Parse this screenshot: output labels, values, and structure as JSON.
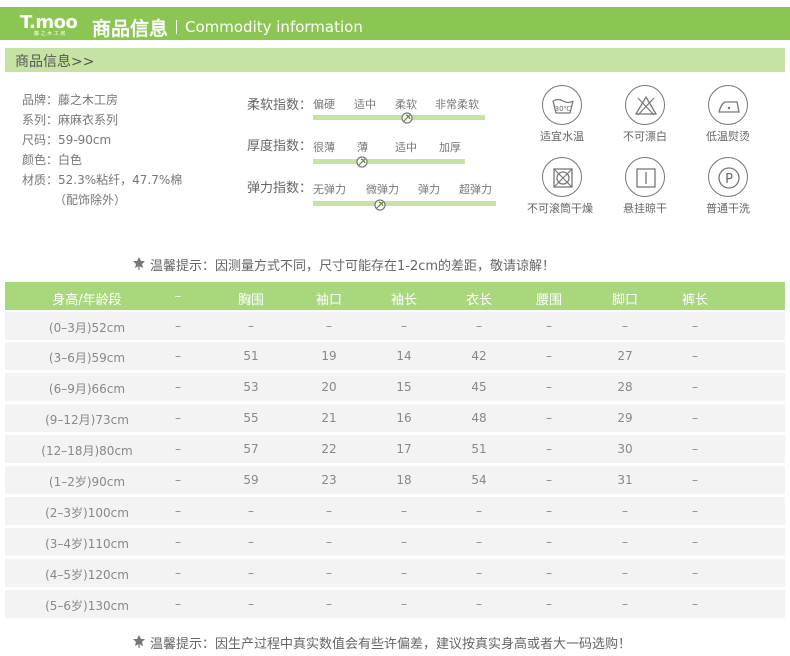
{
  "header": {
    "logo": "T.moo",
    "logo_sub": "藤 之 木 工 房",
    "title": "商品信息",
    "title_en": "Commodity information",
    "subtitle": "商品信息>>"
  },
  "info": [
    "品牌：藤之木工房",
    "系列：麻麻衣系列",
    "尺码：59-90cm",
    "颜色：白色",
    "材质：52.3%粘纤，47.7%棉",
    "（配饰除外）"
  ],
  "indices": [
    {
      "label": "柔软指数：",
      "options": [
        "偏硬",
        "适中",
        "柔软",
        "非常柔软"
      ],
      "selected": 2
    },
    {
      "label": "厚度指数：",
      "options": [
        "很薄",
        "薄",
        "适中",
        "加厚"
      ],
      "selected": 1
    },
    {
      "label": "弹力指数：",
      "options": [
        "无弹力",
        "微弹力",
        "弹力",
        "超弹力"
      ],
      "selected": 1
    }
  ],
  "care": [
    {
      "label": "适宜水温",
      "icon": "wash-30-icon",
      "text": "30℃"
    },
    {
      "label": "不可漂白",
      "icon": "no-bleach-icon"
    },
    {
      "label": "低温熨烫",
      "icon": "iron-low-icon"
    },
    {
      "label": "不可滚筒干燥",
      "icon": "no-tumble-dry-icon"
    },
    {
      "label": "悬挂晾干",
      "icon": "hang-dry-icon"
    },
    {
      "label": "普通干洗",
      "icon": "dry-clean-icon",
      "text": "P"
    }
  ],
  "tip1": "温馨提示：因测量方式不同，尺寸可能存在1-2cm的差距，敬请谅解！",
  "tip2": "温馨提示：因生产过程中真实数值会有些许偏差，建议按真实身高或者大一码选购！",
  "table": {
    "headers": [
      "身高/年龄段",
      "–",
      "胸围",
      "袖口",
      "袖长",
      "衣长",
      "腰围",
      "脚口",
      "裤长"
    ],
    "rows": [
      [
        "(0–3月)52cm",
        "–",
        "–",
        "–",
        "–",
        "–",
        "–",
        "–",
        "–"
      ],
      [
        "(3–6月)59cm",
        "–",
        "51",
        "19",
        "14",
        "42",
        "–",
        "27",
        "–"
      ],
      [
        "(6–9月)66cm",
        "–",
        "53",
        "20",
        "15",
        "45",
        "–",
        "28",
        "–"
      ],
      [
        "(9–12月)73cm",
        "–",
        "55",
        "21",
        "16",
        "48",
        "–",
        "29",
        "–"
      ],
      [
        "(12–18月)80cm",
        "–",
        "57",
        "22",
        "17",
        "51",
        "–",
        "30",
        "–"
      ],
      [
        "(1–2岁)90cm",
        "–",
        "59",
        "23",
        "18",
        "54",
        "–",
        "31",
        "–"
      ],
      [
        "(2–3岁)100cm",
        "–",
        "–",
        "–",
        "–",
        "–",
        "–",
        "–",
        "–"
      ],
      [
        "(3–4岁)110cm",
        "–",
        "–",
        "–",
        "–",
        "–",
        "–",
        "–",
        "–"
      ],
      [
        "(4–5岁)120cm",
        "–",
        "–",
        "–",
        "–",
        "–",
        "–",
        "–",
        "–"
      ],
      [
        "(5–6岁)130cm",
        "–",
        "–",
        "–",
        "–",
        "–",
        "–",
        "–",
        "–"
      ]
    ]
  },
  "colors": {
    "green": "#8bc652",
    "light_green": "#c6e3a3",
    "header_green": "#a9d77c"
  }
}
